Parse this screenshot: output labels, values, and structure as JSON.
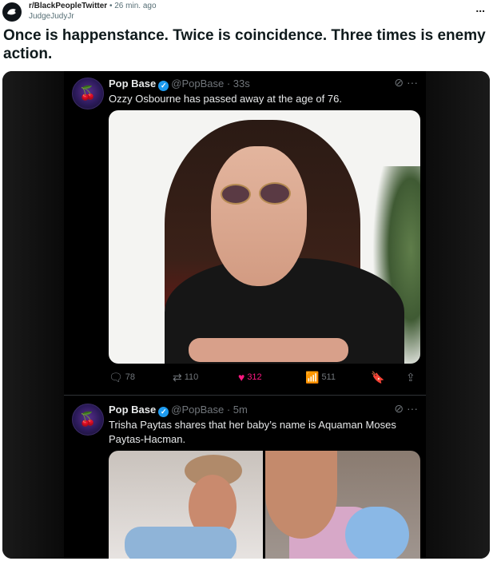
{
  "post": {
    "subreddit": "r/BlackPeopleTwitter",
    "time": "• 26 min. ago",
    "author": "JudgeJudyJr",
    "more_label": "...",
    "title": "Once is happenstance. Twice is coincidence. Three times is enemy action."
  },
  "tweets": [
    {
      "name": "Pop Base",
      "handle": "@PopBase · 33s",
      "text": "Ozzy Osbourne has passed away at the age  of 76.",
      "more": "···",
      "stats": {
        "replies": "78",
        "reposts": "110",
        "likes": "312",
        "views": "511"
      }
    },
    {
      "name": "Pop Base",
      "handle": "@PopBase · 5m",
      "text": "Trisha Paytas shares that her baby’s name is Aquaman Moses Paytas-Hacman.",
      "more": "···"
    }
  ],
  "colors": {
    "verified": "#1d9bf0",
    "like": "#f91880",
    "tweet_bg": "#000000"
  },
  "icons": [
    "subreddit-icon",
    "more-icon",
    "grok-icon",
    "verified-icon",
    "reply-icon",
    "repost-icon",
    "like-icon",
    "views-icon",
    "bookmark-icon",
    "share-icon"
  ]
}
